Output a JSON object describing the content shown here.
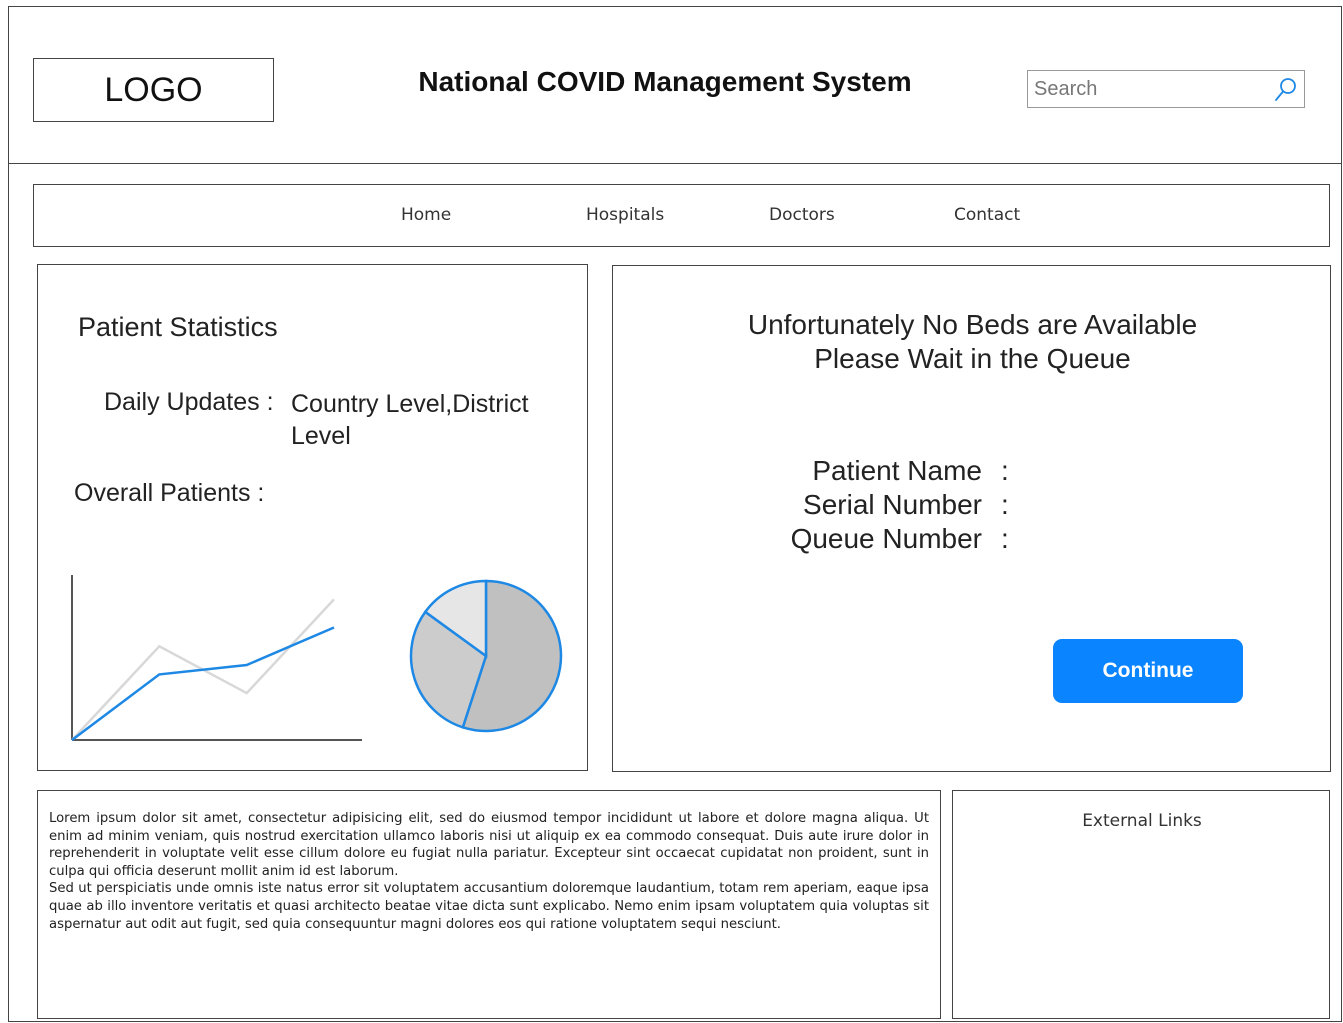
{
  "header": {
    "logo": "LOGO",
    "title": "National COVID Management System",
    "search_placeholder": "Search"
  },
  "nav": {
    "items": [
      "Home",
      "Hospitals",
      "Doctors",
      "Contact"
    ]
  },
  "stats": {
    "title": "Patient Statistics",
    "daily_label": "Daily Updates :",
    "daily_value": "Country Level,District Level",
    "overall_label": "Overall Patients :"
  },
  "chart_data": [
    {
      "type": "line",
      "series": [
        {
          "values": [
            0,
            35,
            40,
            60
          ],
          "color": "#1e88e5"
        },
        {
          "values": [
            0,
            50,
            25,
            75
          ],
          "color": "#d8d8d8"
        }
      ]
    },
    {
      "type": "pie",
      "values": [
        55,
        30,
        15
      ],
      "colors": [
        "#c0c0c0",
        "#cccccc",
        "#e6e6e6"
      ],
      "stroke": "#1e88e5"
    }
  ],
  "queue": {
    "message_line1": "Unfortunately No Beds are Available",
    "message_line2": "Please Wait in the Queue",
    "fields": [
      {
        "label": "Patient Name",
        "colon": ":"
      },
      {
        "label": "Serial Number",
        "colon": ":"
      },
      {
        "label": "Queue Number",
        "colon": ":"
      }
    ],
    "continue_label": "Continue"
  },
  "footer": {
    "paragraph1": "Lorem ipsum dolor sit amet, consectetur adipisicing elit, sed do eiusmod tempor incididunt ut labore et dolore magna aliqua. Ut enim ad minim veniam, quis nostrud exercitation ullamco laboris nisi ut aliquip ex ea commodo consequat. Duis aute irure dolor in reprehenderit in voluptate velit esse cillum dolore eu fugiat nulla pariatur. Excepteur sint occaecat cupidatat non proident, sunt in culpa qui officia deserunt mollit anim id est laborum.",
    "paragraph2": "Sed ut perspiciatis unde omnis iste natus error sit voluptatem accusantium doloremque laudantium, totam rem aperiam, eaque ipsa quae ab illo inventore veritatis et quasi architecto beatae vitae dicta sunt explicabo. Nemo enim ipsam voluptatem quia voluptas sit aspernatur aut odit aut fugit, sed quia consequuntur magni dolores eos qui ratione voluptatem sequi nesciunt.",
    "links_title": "External Links"
  },
  "colors": {
    "accent": "#0a84ff",
    "chart_blue": "#1e88e5",
    "border": "#444444"
  }
}
